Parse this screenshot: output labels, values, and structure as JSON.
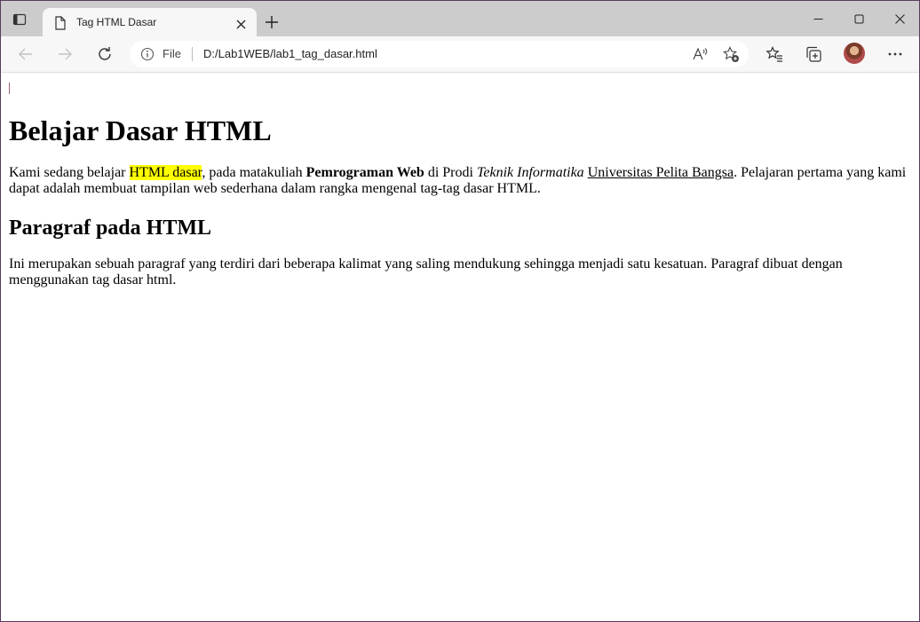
{
  "browser": {
    "tab": {
      "title": "Tag HTML Dasar"
    },
    "address_bar": {
      "scheme_label": "File",
      "url": "D:/Lab1WEB/lab1_tag_dasar.html"
    }
  },
  "page": {
    "heading": "Belajar Dasar HTML",
    "paragraph1": {
      "t1": "Kami sedang belajar ",
      "highlight": "HTML dasar",
      "t2": ", pada matakuliah ",
      "bold": "Pemrograman Web",
      "t3": " di Prodi ",
      "italic": "Teknik Informatika",
      "t4": " ",
      "underline": "Universitas Pelita Bangsa",
      "t5": ". Pelajaran pertama yang kami dapat adalah membuat tampilan web sederhana dalam rangka mengenal tag-tag dasar HTML."
    },
    "subheading": "Paragraf pada HTML",
    "paragraph2": "Ini merupakan sebuah paragraf yang terdiri dari beberapa kalimat yang saling mendukung sehingga menjadi satu kesatuan. Paragraf dibuat dengan menggunakan tag dasar html."
  },
  "icons": {
    "tab_actions": "tab-actions-icon",
    "favicon": "page-icon",
    "tab_close": "close-icon",
    "new_tab": "plus-icon",
    "minimize": "minimize-icon",
    "maximize": "maximize-icon",
    "close_window": "close-icon",
    "back": "arrow-left-icon",
    "forward": "arrow-right-icon",
    "refresh": "refresh-icon",
    "info": "info-icon",
    "read_aloud": "read-aloud-icon",
    "add_favorite": "star-plus-icon",
    "favorites": "favorites-icon",
    "collections": "collections-icon",
    "profile": "avatar",
    "more": "more-icon"
  },
  "colors": {
    "tabstrip_bg": "#cccccc",
    "toolbar_bg": "#f7f7f7",
    "highlight": "#ffff00"
  }
}
